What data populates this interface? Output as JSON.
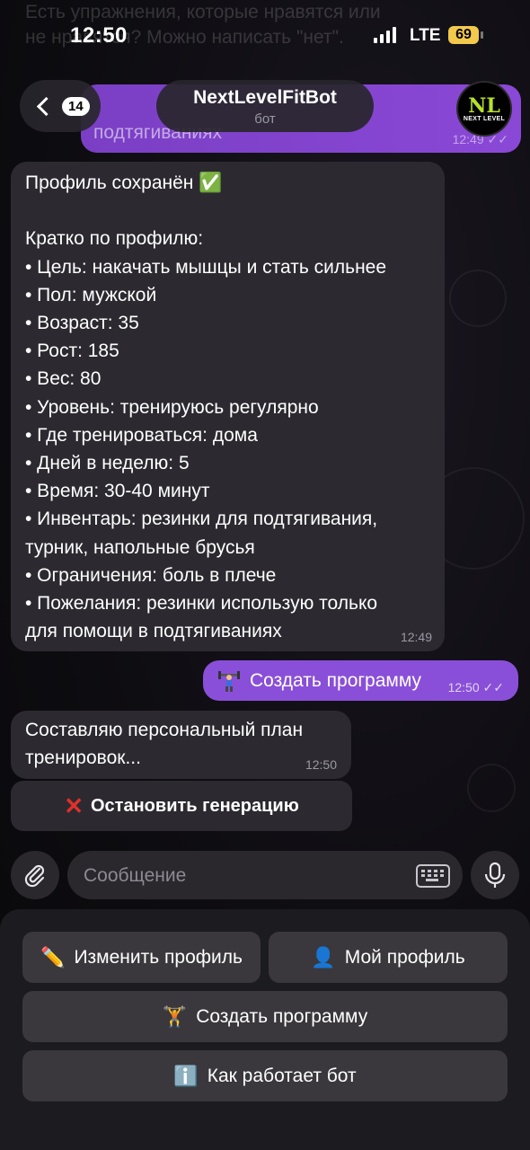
{
  "status": {
    "time": "12:50",
    "network": "LTE",
    "battery": "69"
  },
  "ghost_text": {
    "line1": "Есть упражнения, которые нравятся или",
    "line2": "не нравятся? Можно написать \"нет\"."
  },
  "header": {
    "back_count": "14",
    "bot_name": "NextLevelFitBot",
    "bot_subtitle": "бот",
    "avatar_logo": "NL",
    "avatar_text": "NEXT LEVEL"
  },
  "top_message": {
    "text": "подтягиваниях",
    "time": "12:49"
  },
  "profile_message": {
    "lines": [
      "Профиль сохранён ✅",
      "",
      "Кратко по профилю:",
      "• Цель: накачать мышцы и стать сильнее",
      "• Пол: мужской",
      "• Возраст: 35",
      "• Рост: 185",
      "• Вес: 80",
      "• Уровень: тренируюсь регулярно",
      "• Где тренироваться: дома",
      "• Дней в неделю: 5",
      "• Время: 30-40 минут",
      "• Инвентарь: резинки для подтягивания,",
      "турник, напольные брусья",
      "• Ограничения: боль в плече",
      "• Пожелания: резинки использую только",
      "для помощи в подтягиваниях"
    ],
    "time": "12:49"
  },
  "outgoing_message": {
    "text": "Создать программу",
    "time": "12:50"
  },
  "generating_message": {
    "lines": [
      "Составляю персональный план",
      "тренировок..."
    ],
    "time": "12:50"
  },
  "inline_button": {
    "label": "Остановить генерацию"
  },
  "input": {
    "placeholder": "Сообщение"
  },
  "keyboard": {
    "edit_profile": "Изменить профиль",
    "my_profile": "Мой профиль",
    "create_program": "Создать программу",
    "how_it_works": "Как работает бот"
  },
  "colors": {
    "outgoing": "#8a4fd8",
    "incoming": "#2c2a30",
    "accent": "#b8e02a",
    "battery": "#f2c94c"
  },
  "icons": [
    "back-chevron-icon",
    "attach-icon",
    "keyboard-icon",
    "microphone-icon",
    "pencil-icon",
    "user-icon",
    "weightlifter-icon",
    "info-icon",
    "cross-icon",
    "double-check-icon"
  ]
}
